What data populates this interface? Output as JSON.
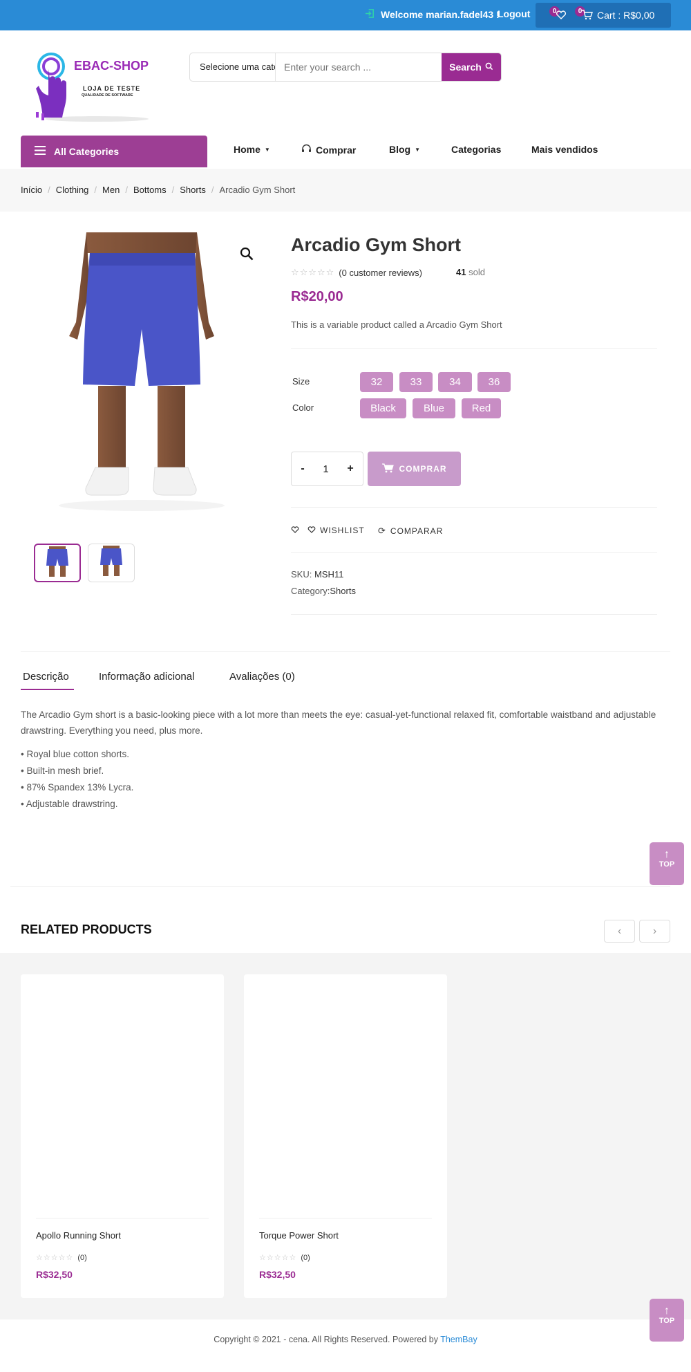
{
  "topbar": {
    "welcome": "Welcome marian.fadel43 !",
    "logout": "Logout",
    "wishlist_count": "0",
    "cart_count": "0",
    "cart_label": "Cart : R$0,00"
  },
  "header": {
    "logo_title": "EBAC-SHOP",
    "logo_sub1": "LOJA DE TESTE",
    "logo_sub2": "QUALIDADE DE SOFTWARE",
    "category_select": "Selecione uma categoria",
    "search_placeholder": "Enter your search ...",
    "search_button": "Search"
  },
  "nav": {
    "all_categories": "All Categories",
    "items": [
      "Home",
      "Comprar",
      "Blog",
      "Categorias",
      "Mais vendidos"
    ]
  },
  "breadcrumb": [
    "Início",
    "Clothing",
    "Men",
    "Bottoms",
    "Shorts",
    "Arcadio Gym Short"
  ],
  "product": {
    "title": "Arcadio Gym Short",
    "reviews": "(0 customer reviews)",
    "sold_count": "41",
    "sold_label": "sold",
    "price": "R$20,00",
    "short_description": "This is a variable product called a Arcadio Gym Short",
    "size_label": "Size",
    "sizes": [
      "32",
      "33",
      "34",
      "36"
    ],
    "color_label": "Color",
    "colors": [
      "Black",
      "Blue",
      "Red"
    ],
    "quantity": "1",
    "qty_minus": "-",
    "qty_plus": "+",
    "buy_button": "COMPRAR",
    "wishlist": "WISHLIST",
    "compare": "COMPARAR",
    "sku_label": "SKU:",
    "sku": "MSH11",
    "category_label": "Category:",
    "category": "Shorts",
    "image_color": "#4a55c8"
  },
  "tabs": {
    "items": [
      "Descrição",
      "Informação adicional",
      "Avaliações (0)"
    ],
    "description": "The Arcadio Gym short is a basic-looking piece with a lot more than meets the eye: casual-yet-functional relaxed fit, comfortable waistband and adjustable drawstring. Everything you need, plus more.",
    "bullets": [
      "• Royal blue cotton shorts.",
      "• Built-in mesh brief.",
      "• 87% Spandex 13% Lycra.",
      "• Adjustable drawstring."
    ]
  },
  "top_button": "TOP",
  "related": {
    "heading": "RELATED PRODUCTS",
    "products": [
      {
        "name": "Apollo Running Short",
        "rating": "(0)",
        "price": "R$32,50"
      },
      {
        "name": "Torque Power Short",
        "rating": "(0)",
        "price": "R$32,50"
      }
    ]
  },
  "footer": {
    "copyright": "Copyright © 2021 - cena. All Rights Reserved. Powered by",
    "powered_by": "ThemBay"
  },
  "colors": {
    "brand": "#9a2b92",
    "topbar": "#2a8bd6",
    "swatch": "#c88dc4"
  }
}
